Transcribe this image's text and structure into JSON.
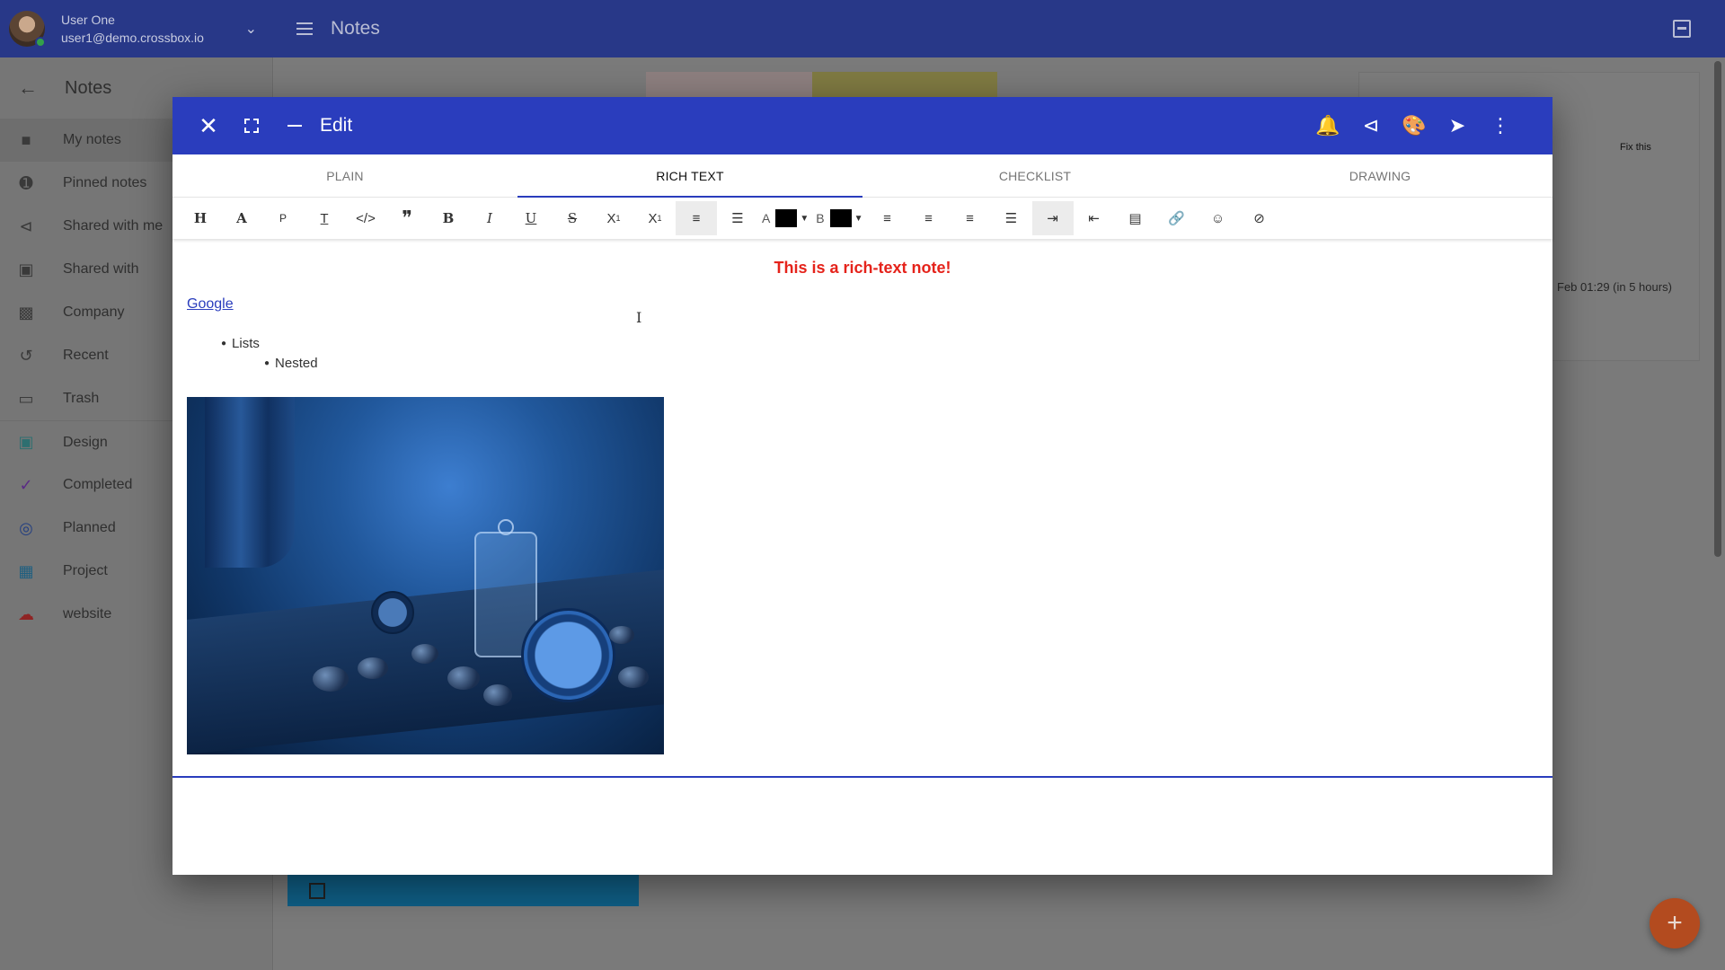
{
  "topbar": {
    "user_name": "User One",
    "user_email": "user1@demo.crossbox.io",
    "title": "Notes"
  },
  "sidebar": {
    "header": "Notes",
    "items": [
      {
        "label": "My notes",
        "icon": "folder-icon"
      },
      {
        "label": "Pinned notes",
        "icon": "pin-icon"
      },
      {
        "label": "Shared with me",
        "icon": "share-icon"
      },
      {
        "label": "Shared with",
        "icon": "lock-icon"
      },
      {
        "label": "Company",
        "icon": "briefcase-icon"
      },
      {
        "label": "Recent",
        "icon": "history-icon"
      },
      {
        "label": "Trash",
        "icon": "trash-icon"
      },
      {
        "label": "Design",
        "icon": "image-icon",
        "color": "#2e8b8b"
      },
      {
        "label": "Completed",
        "icon": "check-icon",
        "color": "#6a2fa0"
      },
      {
        "label": "Planned",
        "icon": "target-icon",
        "color": "#2a4fa8"
      },
      {
        "label": "Project",
        "icon": "grid-icon",
        "color": "#1f7fa8"
      },
      {
        "label": "website",
        "icon": "cloud-icon",
        "color": "#b02a2a"
      }
    ]
  },
  "background": {
    "drawing_label": "Fix this",
    "reminder": "Feb 01:29  (in 5 hours)"
  },
  "modal": {
    "title": "Edit",
    "tabs": [
      "PLAIN",
      "RICH TEXT",
      "CHECKLIST",
      "DRAWING"
    ],
    "active_tab": "RICH TEXT",
    "toolbar": {
      "heading": "H",
      "font": "A",
      "paragraph": "P",
      "text_color_label": "A",
      "bg_color_label": "B",
      "text_color": "#000000",
      "bg_color": "#000000"
    },
    "content": {
      "title": "This is a rich-text note!",
      "title_color": "#e5231b",
      "link": "Google",
      "list_item": "Lists",
      "nested_item": "Nested"
    }
  },
  "colors": {
    "header_blue": "#2a3dbd",
    "fab": "#b34b1f"
  }
}
